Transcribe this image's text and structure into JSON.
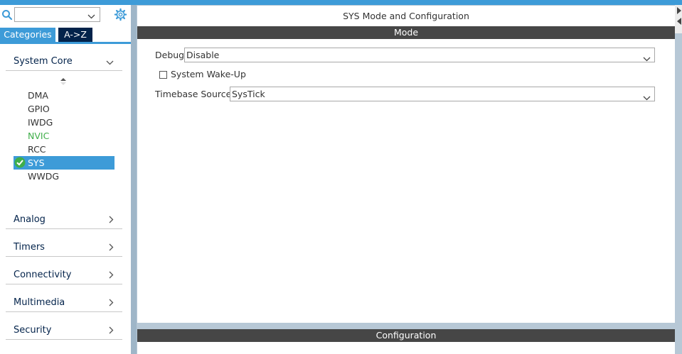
{
  "sidebar": {
    "search": {
      "value": ""
    },
    "tabs": {
      "categories": "Categories",
      "az": "A->Z"
    },
    "categories": [
      {
        "label": "System Core",
        "expanded": true
      },
      {
        "label": "Analog",
        "expanded": false
      },
      {
        "label": "Timers",
        "expanded": false
      },
      {
        "label": "Connectivity",
        "expanded": false
      },
      {
        "label": "Multimedia",
        "expanded": false
      },
      {
        "label": "Security",
        "expanded": false
      }
    ],
    "system_core_items": [
      {
        "label": "DMA",
        "state": "normal"
      },
      {
        "label": "GPIO",
        "state": "normal"
      },
      {
        "label": "IWDG",
        "state": "normal"
      },
      {
        "label": "NVIC",
        "state": "configured"
      },
      {
        "label": "RCC",
        "state": "normal"
      },
      {
        "label": "SYS",
        "state": "selected"
      },
      {
        "label": "WWDG",
        "state": "normal"
      }
    ]
  },
  "main": {
    "title": "SYS Mode and Configuration",
    "mode_section": "Mode",
    "debug": {
      "label": "Debug",
      "value": "Disable"
    },
    "wakeup": {
      "label": "System Wake-Up",
      "checked": false
    },
    "timebase": {
      "label": "Timebase Source",
      "value": "SysTick"
    },
    "config_section": "Configuration"
  },
  "colors": {
    "accent": "#3d9bd8",
    "dark_navy": "#03234b",
    "section_bar": "#464646",
    "configured_green": "#3fae49"
  }
}
